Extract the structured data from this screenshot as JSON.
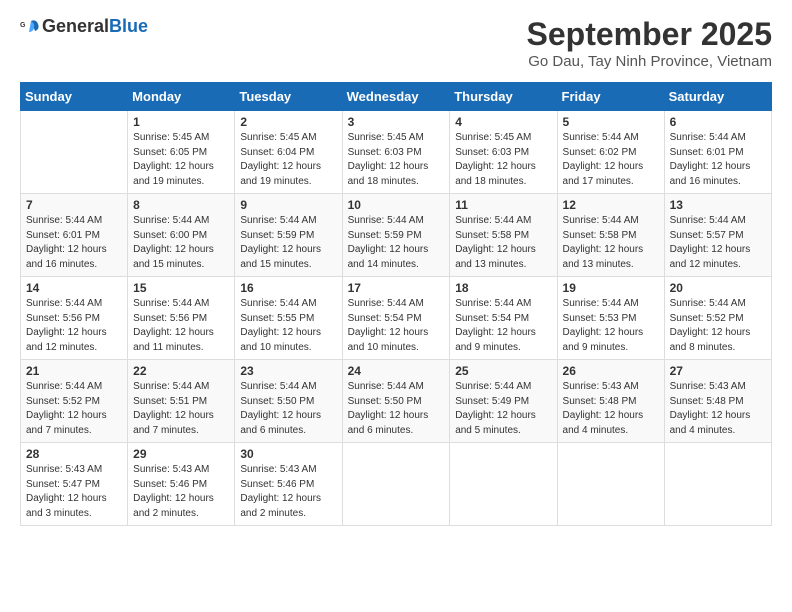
{
  "header": {
    "logo_general": "General",
    "logo_blue": "Blue",
    "month_title": "September 2025",
    "location": "Go Dau, Tay Ninh Province, Vietnam"
  },
  "columns": [
    "Sunday",
    "Monday",
    "Tuesday",
    "Wednesday",
    "Thursday",
    "Friday",
    "Saturday"
  ],
  "weeks": [
    [
      {
        "day": "",
        "info": ""
      },
      {
        "day": "1",
        "info": "Sunrise: 5:45 AM\nSunset: 6:05 PM\nDaylight: 12 hours\nand 19 minutes."
      },
      {
        "day": "2",
        "info": "Sunrise: 5:45 AM\nSunset: 6:04 PM\nDaylight: 12 hours\nand 19 minutes."
      },
      {
        "day": "3",
        "info": "Sunrise: 5:45 AM\nSunset: 6:03 PM\nDaylight: 12 hours\nand 18 minutes."
      },
      {
        "day": "4",
        "info": "Sunrise: 5:45 AM\nSunset: 6:03 PM\nDaylight: 12 hours\nand 18 minutes."
      },
      {
        "day": "5",
        "info": "Sunrise: 5:44 AM\nSunset: 6:02 PM\nDaylight: 12 hours\nand 17 minutes."
      },
      {
        "day": "6",
        "info": "Sunrise: 5:44 AM\nSunset: 6:01 PM\nDaylight: 12 hours\nand 16 minutes."
      }
    ],
    [
      {
        "day": "7",
        "info": "Sunrise: 5:44 AM\nSunset: 6:01 PM\nDaylight: 12 hours\nand 16 minutes."
      },
      {
        "day": "8",
        "info": "Sunrise: 5:44 AM\nSunset: 6:00 PM\nDaylight: 12 hours\nand 15 minutes."
      },
      {
        "day": "9",
        "info": "Sunrise: 5:44 AM\nSunset: 5:59 PM\nDaylight: 12 hours\nand 15 minutes."
      },
      {
        "day": "10",
        "info": "Sunrise: 5:44 AM\nSunset: 5:59 PM\nDaylight: 12 hours\nand 14 minutes."
      },
      {
        "day": "11",
        "info": "Sunrise: 5:44 AM\nSunset: 5:58 PM\nDaylight: 12 hours\nand 13 minutes."
      },
      {
        "day": "12",
        "info": "Sunrise: 5:44 AM\nSunset: 5:58 PM\nDaylight: 12 hours\nand 13 minutes."
      },
      {
        "day": "13",
        "info": "Sunrise: 5:44 AM\nSunset: 5:57 PM\nDaylight: 12 hours\nand 12 minutes."
      }
    ],
    [
      {
        "day": "14",
        "info": "Sunrise: 5:44 AM\nSunset: 5:56 PM\nDaylight: 12 hours\nand 12 minutes."
      },
      {
        "day": "15",
        "info": "Sunrise: 5:44 AM\nSunset: 5:56 PM\nDaylight: 12 hours\nand 11 minutes."
      },
      {
        "day": "16",
        "info": "Sunrise: 5:44 AM\nSunset: 5:55 PM\nDaylight: 12 hours\nand 10 minutes."
      },
      {
        "day": "17",
        "info": "Sunrise: 5:44 AM\nSunset: 5:54 PM\nDaylight: 12 hours\nand 10 minutes."
      },
      {
        "day": "18",
        "info": "Sunrise: 5:44 AM\nSunset: 5:54 PM\nDaylight: 12 hours\nand 9 minutes."
      },
      {
        "day": "19",
        "info": "Sunrise: 5:44 AM\nSunset: 5:53 PM\nDaylight: 12 hours\nand 9 minutes."
      },
      {
        "day": "20",
        "info": "Sunrise: 5:44 AM\nSunset: 5:52 PM\nDaylight: 12 hours\nand 8 minutes."
      }
    ],
    [
      {
        "day": "21",
        "info": "Sunrise: 5:44 AM\nSunset: 5:52 PM\nDaylight: 12 hours\nand 7 minutes."
      },
      {
        "day": "22",
        "info": "Sunrise: 5:44 AM\nSunset: 5:51 PM\nDaylight: 12 hours\nand 7 minutes."
      },
      {
        "day": "23",
        "info": "Sunrise: 5:44 AM\nSunset: 5:50 PM\nDaylight: 12 hours\nand 6 minutes."
      },
      {
        "day": "24",
        "info": "Sunrise: 5:44 AM\nSunset: 5:50 PM\nDaylight: 12 hours\nand 6 minutes."
      },
      {
        "day": "25",
        "info": "Sunrise: 5:44 AM\nSunset: 5:49 PM\nDaylight: 12 hours\nand 5 minutes."
      },
      {
        "day": "26",
        "info": "Sunrise: 5:43 AM\nSunset: 5:48 PM\nDaylight: 12 hours\nand 4 minutes."
      },
      {
        "day": "27",
        "info": "Sunrise: 5:43 AM\nSunset: 5:48 PM\nDaylight: 12 hours\nand 4 minutes."
      }
    ],
    [
      {
        "day": "28",
        "info": "Sunrise: 5:43 AM\nSunset: 5:47 PM\nDaylight: 12 hours\nand 3 minutes."
      },
      {
        "day": "29",
        "info": "Sunrise: 5:43 AM\nSunset: 5:46 PM\nDaylight: 12 hours\nand 2 minutes."
      },
      {
        "day": "30",
        "info": "Sunrise: 5:43 AM\nSunset: 5:46 PM\nDaylight: 12 hours\nand 2 minutes."
      },
      {
        "day": "",
        "info": ""
      },
      {
        "day": "",
        "info": ""
      },
      {
        "day": "",
        "info": ""
      },
      {
        "day": "",
        "info": ""
      }
    ]
  ]
}
